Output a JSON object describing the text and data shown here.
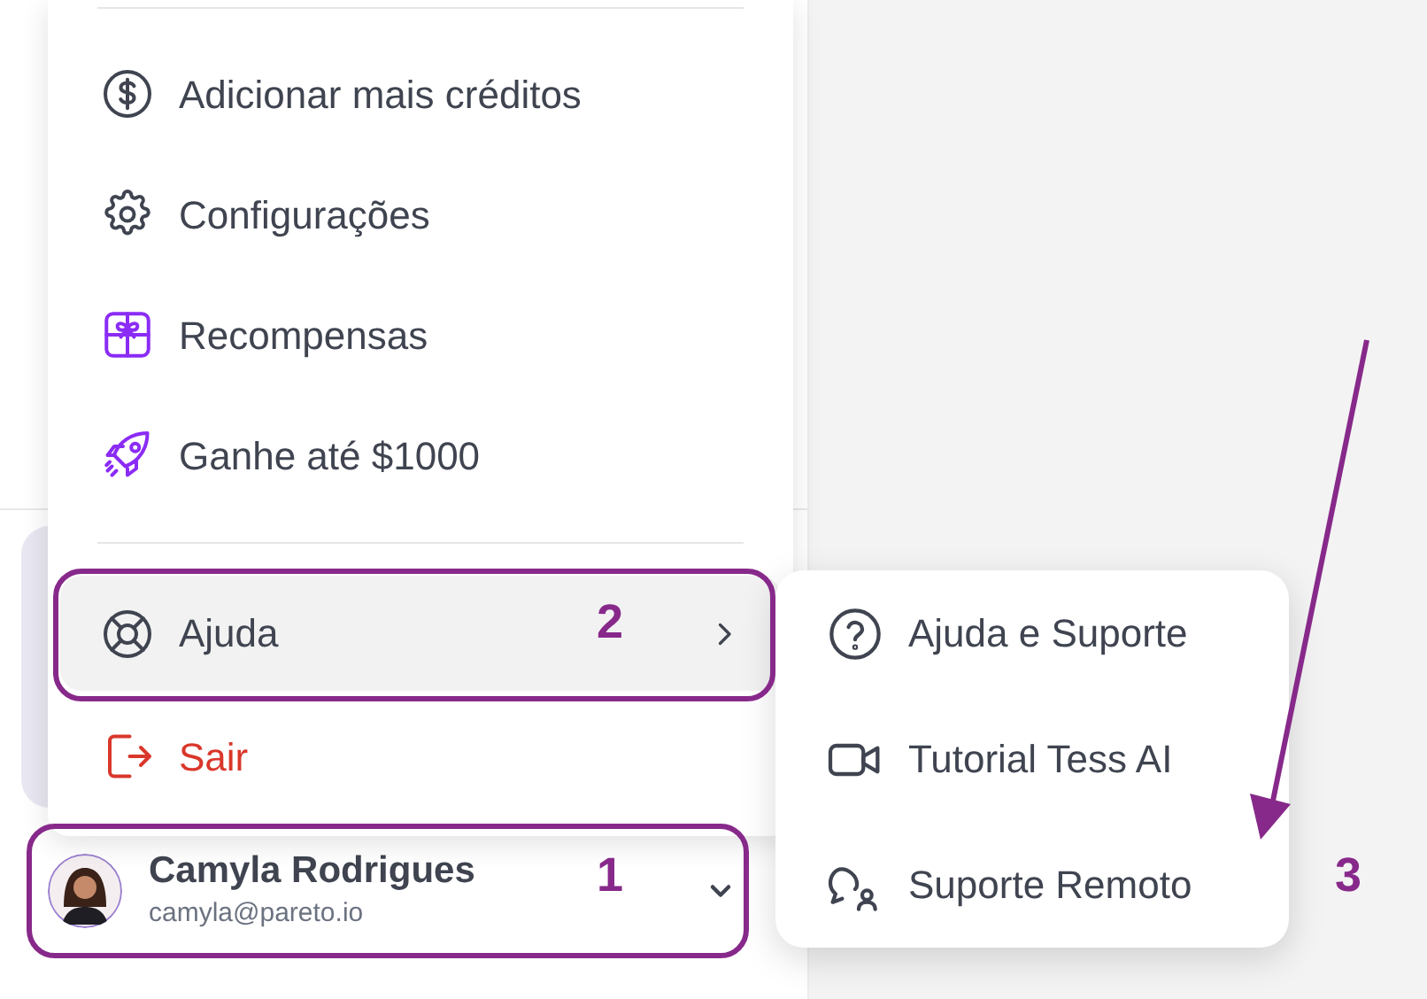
{
  "menu": {
    "groups": [
      [
        {
          "label": "Adicionar mais créditos",
          "kind": "normal",
          "highlighted": false,
          "submenu": false
        },
        {
          "label": "Configurações",
          "kind": "normal",
          "highlighted": false,
          "submenu": false
        },
        {
          "label": "Recompensas",
          "kind": "normal",
          "highlighted": false,
          "submenu": false
        },
        {
          "label": "Ganhe até $1000",
          "kind": "normal",
          "highlighted": false,
          "submenu": false
        }
      ],
      [
        {
          "label": "Ajuda",
          "kind": "normal",
          "highlighted": true,
          "submenu": true
        },
        {
          "label": "Sair",
          "kind": "danger",
          "highlighted": false,
          "submenu": false
        }
      ]
    ]
  },
  "submenu": {
    "items": [
      {
        "label": "Ajuda e Suporte"
      },
      {
        "label": "Tutorial Tess AI"
      },
      {
        "label": "Suporte Remoto"
      }
    ]
  },
  "user": {
    "name": "Camyla Rodrigues",
    "email": "camyla@pareto.io"
  },
  "annotations": [
    {
      "label": "1"
    },
    {
      "label": "2"
    },
    {
      "label": "3"
    }
  ]
}
